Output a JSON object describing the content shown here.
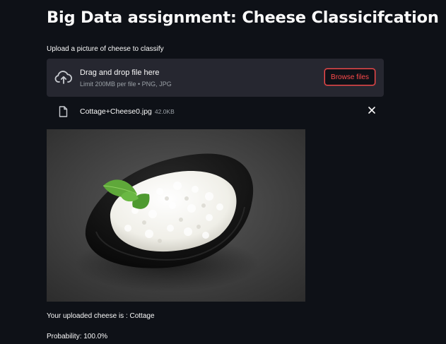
{
  "header": {
    "title": "Big Data assignment: Cheese Classicifcation"
  },
  "uploader": {
    "label": "Upload a picture of cheese to classify",
    "dropzone_title": "Drag and drop file here",
    "dropzone_limits": "Limit 200MB per file • PNG, JPG",
    "browse_label": "Browse files",
    "upload_icon": "cloud-upload-icon"
  },
  "uploaded_file": {
    "name": "Cottage+Cheese0.jpg",
    "size": "42.0KB",
    "file_icon": "file-icon",
    "remove_icon": "close-icon"
  },
  "image": {
    "subject": "bowl of cottage cheese with mint leaf"
  },
  "results": {
    "prediction_text": "Your uploaded cheese is : Cottage",
    "probability_text": "Probability: 100.0%"
  },
  "colors": {
    "background": "#0e1117",
    "dropzone": "#262730",
    "accent": "#ff4b4b",
    "text": "#fafafa",
    "muted": "#9aa0a6"
  }
}
